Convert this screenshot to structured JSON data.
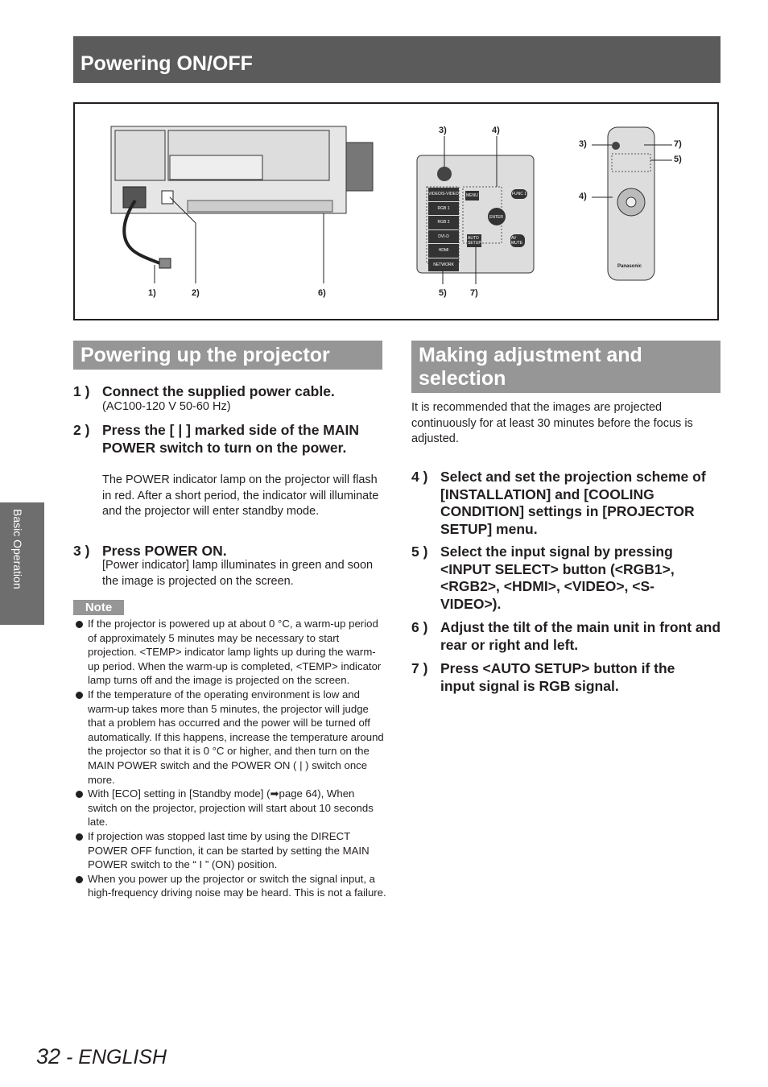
{
  "header": {
    "title": "Powering ON/OFF"
  },
  "figure": {
    "callouts_projector": [
      "1)",
      "2)",
      "6)"
    ],
    "callouts_panel_top": [
      "3)",
      "4)"
    ],
    "callouts_panel_bottom": [
      "5)",
      "7)"
    ],
    "callouts_remote_left": [
      "3)",
      "4)"
    ],
    "callouts_remote_right": [
      "7)",
      "5)"
    ],
    "panel_buttons": [
      "VIDEO/S-VIDEO",
      "RGB 1",
      "RGB 2",
      "DVI-D",
      "HDMI",
      "NETWORK",
      "MENU",
      "FUNC 1",
      "ENTER",
      "AUTO SETUP",
      "AV MUTE"
    ],
    "remote_brand": "Panasonic"
  },
  "left": {
    "title": "Powering up the projector",
    "steps": [
      {
        "num": "1 )",
        "text": "Connect the supplied power cable.",
        "body": "(AC100-120 V    50-60 Hz)"
      },
      {
        "num": "2 )",
        "text": "Press the [ | ] marked side of the MAIN POWER switch to turn on the power.",
        "body": "The POWER indicator lamp on the projector will flash in red. After a short period, the indicator will illuminate and the projector will enter standby mode."
      },
      {
        "num": "3 )",
        "text": "Press POWER ON.",
        "body": "[Power indicator] lamp illuminates in green and soon the image is projected on the screen."
      }
    ],
    "note_label": "Note",
    "notes": [
      "If the projector is powered up at about 0 °C, a warm-up period of approximately 5 minutes may be necessary to start projection. <TEMP> indicator lamp lights up during the warm-up period. When the warm-up is completed, <TEMP> indicator lamp turns off and the image is projected on the screen.",
      "If the temperature of the operating environment is low and warm-up takes more than 5 minutes, the projector will judge that a problem has occurred and the power will be turned off automatically. If this happens, increase the temperature around the projector so that it is 0 °C or higher, and then turn on the MAIN POWER switch and the POWER ON ( | ) switch once more.",
      "With [ECO] setting in [Standby mode] (➡page 64), When switch on the projector, projection will start about 10 seconds late.",
      "If projection was stopped last time by using the DIRECT POWER OFF function, it can be started by setting the MAIN POWER switch to the “ I ” (ON) position.",
      "When you power up the projector or switch the signal input, a high-frequency driving noise may be heard. This is not a failure."
    ]
  },
  "right": {
    "title": "Making adjustment and selection",
    "intro": "It is recommended that the images are projected continuously for at least 30 minutes before the focus is adjusted.",
    "steps": [
      {
        "num": "4 )",
        "text": "Select and set the projection scheme of [INSTALLATION] and [COOLING CONDITION] settings in [PROJECTOR SETUP] menu."
      },
      {
        "num": "5 )",
        "text": "Select the input signal by pressing <INPUT SELECT> button (<RGB1>, <RGB2>, <HDMI>, <VIDEO>, <S-VIDEO>)."
      },
      {
        "num": "6 )",
        "text": "Adjust the tilt of the main unit in front and rear or right and left."
      },
      {
        "num": "7 )",
        "text": "Press <AUTO SETUP> button if the input signal is RGB signal."
      }
    ]
  },
  "sidetab": {
    "label": "Basic Operation"
  },
  "footer": {
    "page": "32",
    "sep": " - ",
    "lang": "ENGLISH"
  },
  "colors": {
    "header_bar": "#5b5b5b",
    "section_bar": "#969696",
    "side_tab": "#6e6e6e"
  }
}
